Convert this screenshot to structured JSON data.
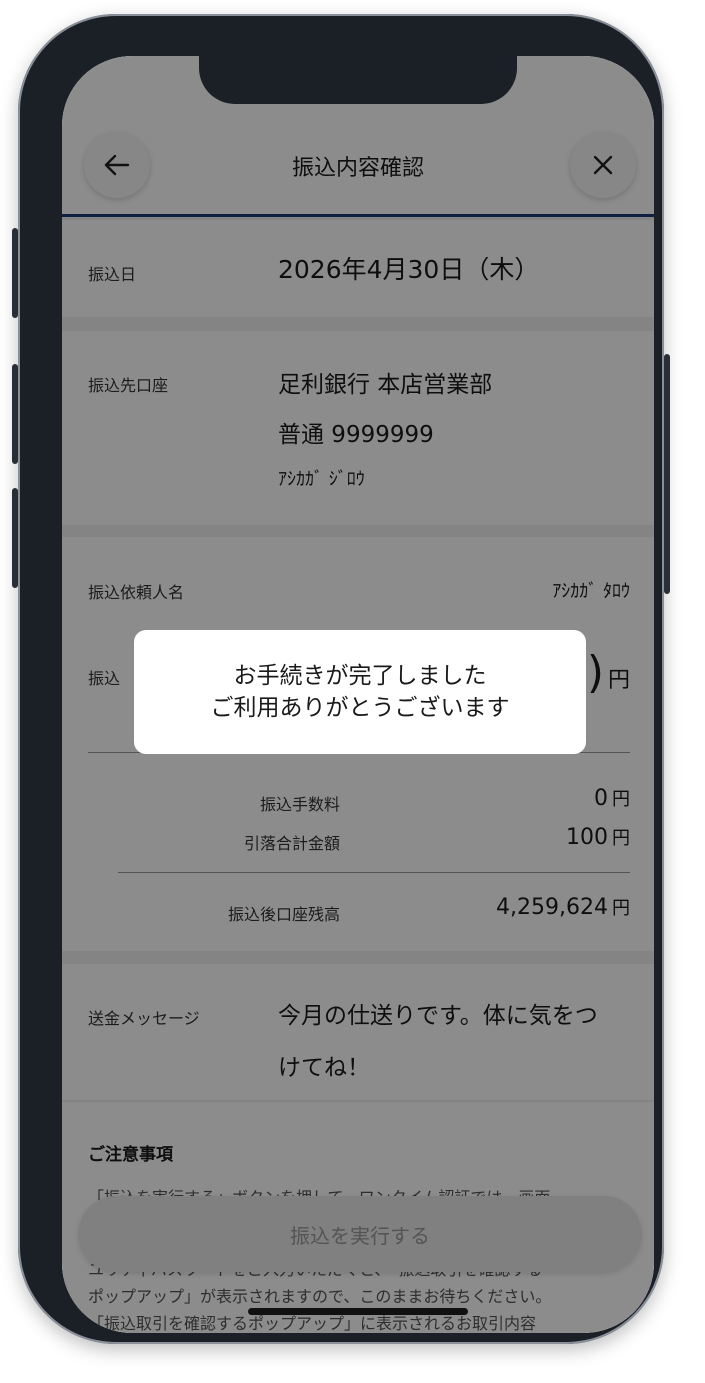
{
  "header": {
    "title": "振込内容確認"
  },
  "transfer_date": {
    "label": "振込日",
    "value": "2026年4月30日（木）"
  },
  "destination": {
    "label": "振込先口座",
    "bank": "足利銀行 本店営業部",
    "account": "普通 9999999",
    "holder_kana": "ｱｼｶｶﾞ ｼﾞﾛｳ"
  },
  "requester": {
    "label": "振込依頼人名",
    "value": "ｱｼｶｶﾞ ﾀﾛｳ"
  },
  "amount": {
    "label_visible": "振込",
    "value_visible": ")",
    "unit": "円"
  },
  "fees": {
    "fee_label": "振込手数料",
    "fee_value": "0",
    "fee_unit": "円",
    "total_label": "引落合計金額",
    "total_value": "100",
    "total_unit": "円",
    "balance_label": "振込後口座残高",
    "balance_value": "4,259,624",
    "balance_unit": "円"
  },
  "message": {
    "label": "送金メッセージ",
    "line1": "今月の仕送りです。体に気をつ",
    "line2": "けてね！"
  },
  "notes": {
    "title": "ご注意事項",
    "line1": "「振込を実行する」ボタンを押して、ワンタイム認証では、画面",
    "line2": "ユリティパスワードをご入力いただくと、「振込取引を確認する",
    "line3": "ポップアップ」が表示されますので、このままお待ちください。",
    "line4": "「振込取引を確認するポップアップ」に表示されるお取引内容"
  },
  "execute_button": {
    "label": "振込を実行する"
  },
  "dialog": {
    "line1": "お手続きが完了しました",
    "line2": "ご利用ありがとうございます"
  },
  "icons": {
    "back": "arrow-left-icon",
    "close": "close-icon"
  }
}
